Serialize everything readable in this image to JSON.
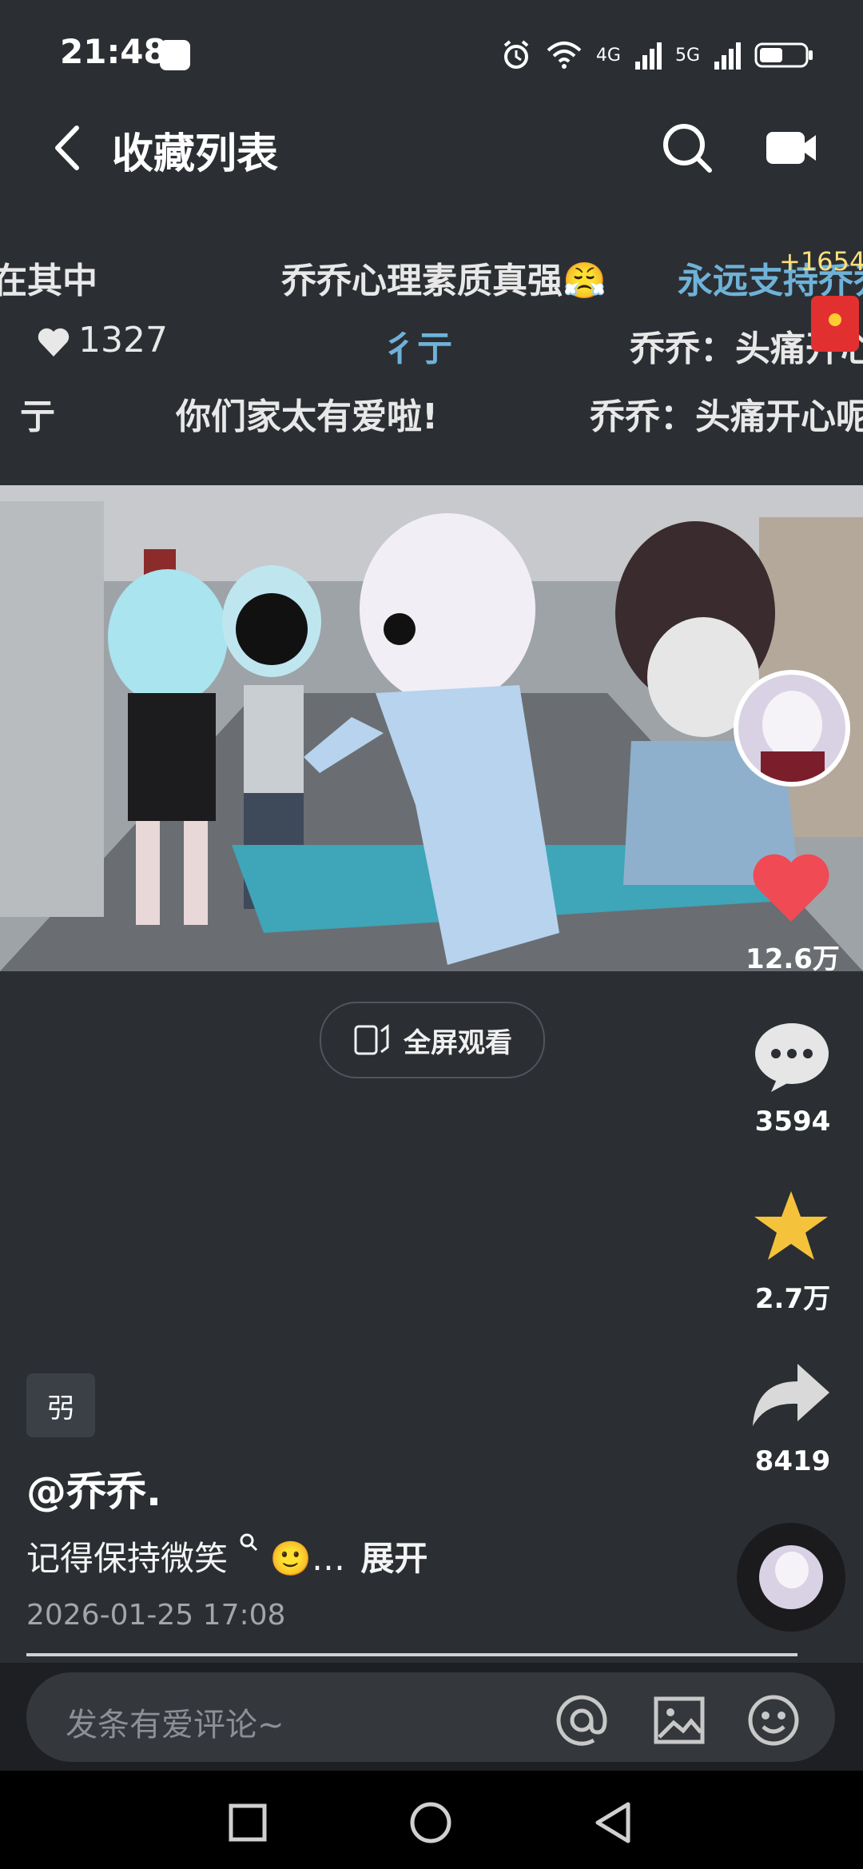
{
  "status_bar": {
    "time": "21:48",
    "network_labels": [
      "4G",
      "5G"
    ],
    "icons": [
      "alarm-icon",
      "wifi-icon",
      "signal-4g-icon",
      "signal-5g-icon",
      "battery-icon"
    ]
  },
  "header": {
    "title": "收藏列表",
    "back_icon": "chevron-left-icon",
    "search_icon": "search-icon",
    "video_icon": "video-icon"
  },
  "danmaku": {
    "row1": [
      "在其中",
      "乔乔心理素质真强😤",
      "永远支持乔乔"
    ],
    "row2": [
      "1327",
      "彳亍",
      "乔乔：头痛开心"
    ],
    "row3": [
      "亍",
      "你们家太有爱啦!",
      "乔乔：头痛开心呢"
    ],
    "envelope_count": "+1654"
  },
  "fullscreen_label": "全屏观看",
  "actions": {
    "like_count": "12.6万",
    "comment_count": "3594",
    "favorite_count": "2.7万",
    "share_count": "8419"
  },
  "post": {
    "tag": "弜",
    "author": "@乔乔.",
    "description": "记得保持微笑",
    "description_emoji": "🙂…",
    "expand": "展开",
    "date": "2026-01-25 17:08"
  },
  "comment_bar": {
    "placeholder": "发条有爱评论~"
  },
  "colors": {
    "background": "#2b2f33",
    "like_red": "#f04a55",
    "star_gold": "#f5c33b",
    "danmaku_blue": "#6fb2d9"
  }
}
